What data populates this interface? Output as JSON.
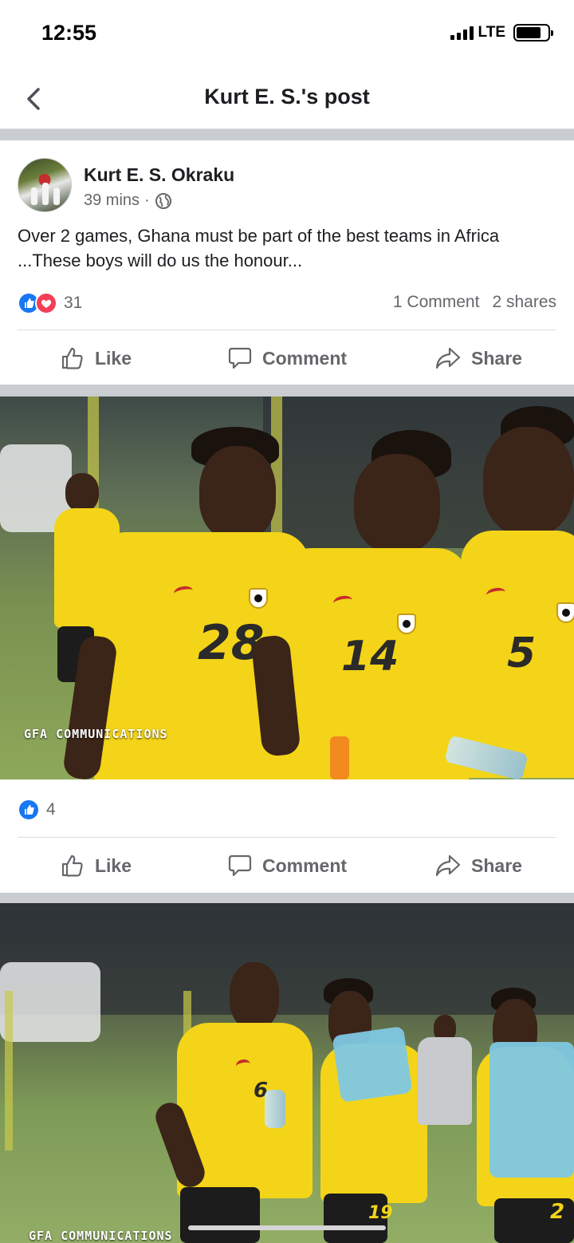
{
  "status_bar": {
    "time": "12:55",
    "network": "LTE"
  },
  "nav": {
    "title": "Kurt E. S.'s post",
    "back_icon": "chevron-left-icon"
  },
  "post": {
    "author": "Kurt E. S. Okraku",
    "time": "39 mins",
    "separator": "·",
    "privacy_icon": "globe-icon",
    "text": "Over 2 games, Ghana must be part of the best teams in Africa ...These boys will do us the honour...",
    "reaction_count": "31",
    "comments": "1 Comment",
    "shares": "2 shares"
  },
  "actions": {
    "like": "Like",
    "comment": "Comment",
    "share": "Share"
  },
  "photos": [
    {
      "watermark": "GFA COMMUNICATIONS",
      "jersey_numbers": [
        "28",
        "14",
        "5"
      ],
      "reaction_count": "4"
    },
    {
      "watermark": "GFA COMMUNICATIONS",
      "jersey_numbers": [
        "6",
        "19",
        "2"
      ]
    }
  ],
  "colors": {
    "like_blue": "#1877f2",
    "love_red": "#f33e58",
    "jersey_yellow": "#f3d418",
    "secondary_text": "#65676b"
  }
}
